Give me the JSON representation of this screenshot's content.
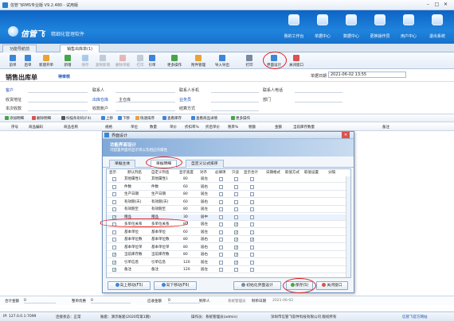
{
  "window": {
    "title": "信管飞RMS专业版 V9.2.480 - 试用版"
  },
  "brand": {
    "name": "信管飞",
    "tagline": "精细化管理软件"
  },
  "nav": [
    {
      "label": "我的工作台"
    },
    {
      "label": "单据中心"
    },
    {
      "label": "数据中心"
    },
    {
      "label": "更换操作员"
    },
    {
      "label": "用户中心"
    },
    {
      "label": "退出系统"
    }
  ],
  "tabs": [
    {
      "label": "功能导航前"
    },
    {
      "label": "销售出库单(1)"
    }
  ],
  "toolbar": [
    {
      "label": "前单"
    },
    {
      "label": "后单"
    },
    {
      "label": "新建开单"
    },
    {
      "label": "新增"
    },
    {
      "label": "保存"
    },
    {
      "label": "复制新增"
    },
    {
      "label": "删除单据"
    },
    {
      "label": "打印"
    },
    {
      "label": "引单"
    },
    {
      "label": "更多操作"
    },
    {
      "label": "附件管理"
    },
    {
      "label": "导入导出"
    },
    {
      "label": "打印"
    },
    {
      "label": "界面设计"
    },
    {
      "label": "关闭窗口"
    }
  ],
  "form": {
    "title": "销售出库单",
    "status": "待审核",
    "date_label": "单据日期",
    "date_value": "2021-06-02 13:55",
    "order_no_label": "单据编号",
    "fields": [
      [
        "客户",
        "联系人",
        "联系人手机",
        "联系人电话"
      ],
      [
        "收货地址",
        "出库仓库",
        "业务员",
        "部门"
      ],
      [
        "本次收款",
        "收款账户",
        "结算方式",
        ""
      ]
    ],
    "warehouse": "主仓库"
  },
  "subtoolbar": [
    {
      "label": "添加明细"
    },
    {
      "label": "删除明细"
    },
    {
      "label": "扫描条形码(F4)"
    },
    {
      "label": "上移"
    },
    {
      "label": "下移"
    },
    {
      "label": "快速排序"
    },
    {
      "label": "查看库存"
    },
    {
      "label": "查看商品详情"
    },
    {
      "label": "更多操作"
    }
  ],
  "grid_headers": [
    "序号",
    "商品编码",
    "商品名称",
    "规格",
    "单位",
    "数量",
    "单价",
    "折扣率%",
    "折后单价",
    "税率%",
    "税额",
    "金额",
    "当前库存数量",
    "备注"
  ],
  "footer": {
    "qty_label": "合计金额",
    "qty_value": "0",
    "discount_label": "整单优惠",
    "discount_value": "0",
    "total_label": "应收金额",
    "total_value": "0",
    "creator_label": "制单人",
    "creator_value": "系统管理员",
    "created_label": "制单日期",
    "created_value": "2021-06-02"
  },
  "status": {
    "items": [
      "IP: 127.0.0.1:7099",
      "连接状态：正常",
      "账套：演示账套(2020年第1期)",
      "操作员：系统管理员(admin)",
      "深圳市信管飞软件科技有限公司 版权所有",
      "信管飞官方网站"
    ]
  },
  "dialog": {
    "title": "界面设计",
    "banner_title": "功能界面设计",
    "banner_sub": "可配置界面的显示项以及相应的属性",
    "tabs": [
      {
        "label": "单据主体"
      },
      {
        "label": "单据明细"
      },
      {
        "label": "自定义公式排序"
      }
    ],
    "columns": [
      "显示",
      "默认列名",
      "自定义列名",
      "显示宽度",
      "对齐",
      "必填项",
      "只读",
      "显示合计",
      "日期格式",
      "取值方式",
      "取值设置",
      "分隔"
    ],
    "rows": [
      {
        "show": false,
        "name": "其他属性1",
        "custom": "其他属性1",
        "width": "80",
        "align": "居左",
        "req": false,
        "ro": false,
        "sum": false
      },
      {
        "show": false,
        "name": "件数",
        "custom": "件数",
        "width": "60",
        "align": "居右",
        "req": false,
        "ro": false,
        "sum": false
      },
      {
        "show": false,
        "name": "生产日期",
        "custom": "生产日期",
        "width": "80",
        "align": "居左",
        "req": false,
        "ro": false,
        "sum": false
      },
      {
        "show": false,
        "name": "有效期(天)",
        "custom": "有效期(天)",
        "width": "60",
        "align": "居右",
        "req": false,
        "ro": false,
        "sum": false
      },
      {
        "show": false,
        "name": "有效期至",
        "custom": "有效期至",
        "width": "80",
        "align": "居左",
        "req": false,
        "ro": false,
        "sum": false
      },
      {
        "show": true,
        "name": "赠品",
        "custom": "赠品",
        "width": "30",
        "align": "居中",
        "req": false,
        "ro": false,
        "sum": false,
        "sel": true
      },
      {
        "show": false,
        "name": "多单位关系",
        "custom": "多单位关系",
        "width": "80",
        "align": "居左",
        "req": false,
        "ro": true,
        "sum": false
      },
      {
        "show": false,
        "name": "基本单位",
        "custom": "基本单位",
        "width": "60",
        "align": "居左",
        "req": false,
        "ro": true,
        "sum": false
      },
      {
        "show": false,
        "name": "基本单位数",
        "custom": "基本单位数",
        "width": "80",
        "align": "居右",
        "req": false,
        "ro": true,
        "sum": true
      },
      {
        "show": false,
        "name": "基本单位单",
        "custom": "基本单位单",
        "width": "80",
        "align": "居右",
        "req": false,
        "ro": true,
        "sum": false
      },
      {
        "show": true,
        "name": "当前库存数",
        "custom": "当前库存数",
        "width": "80",
        "align": "居右",
        "req": false,
        "ro": true,
        "sum": false
      },
      {
        "show": true,
        "name": "引单信息",
        "custom": "引单信息",
        "width": "120",
        "align": "居左",
        "req": false,
        "ro": true,
        "sum": false
      },
      {
        "show": true,
        "name": "备注",
        "custom": "备注",
        "width": "120",
        "align": "居左",
        "req": false,
        "ro": false,
        "sum": false
      }
    ],
    "buttons": {
      "up": "向上移动(F5)",
      "down": "向下移动(F6)",
      "restore": "初始化界面设计",
      "save": "保存(S)",
      "close": "关闭窗口"
    }
  }
}
